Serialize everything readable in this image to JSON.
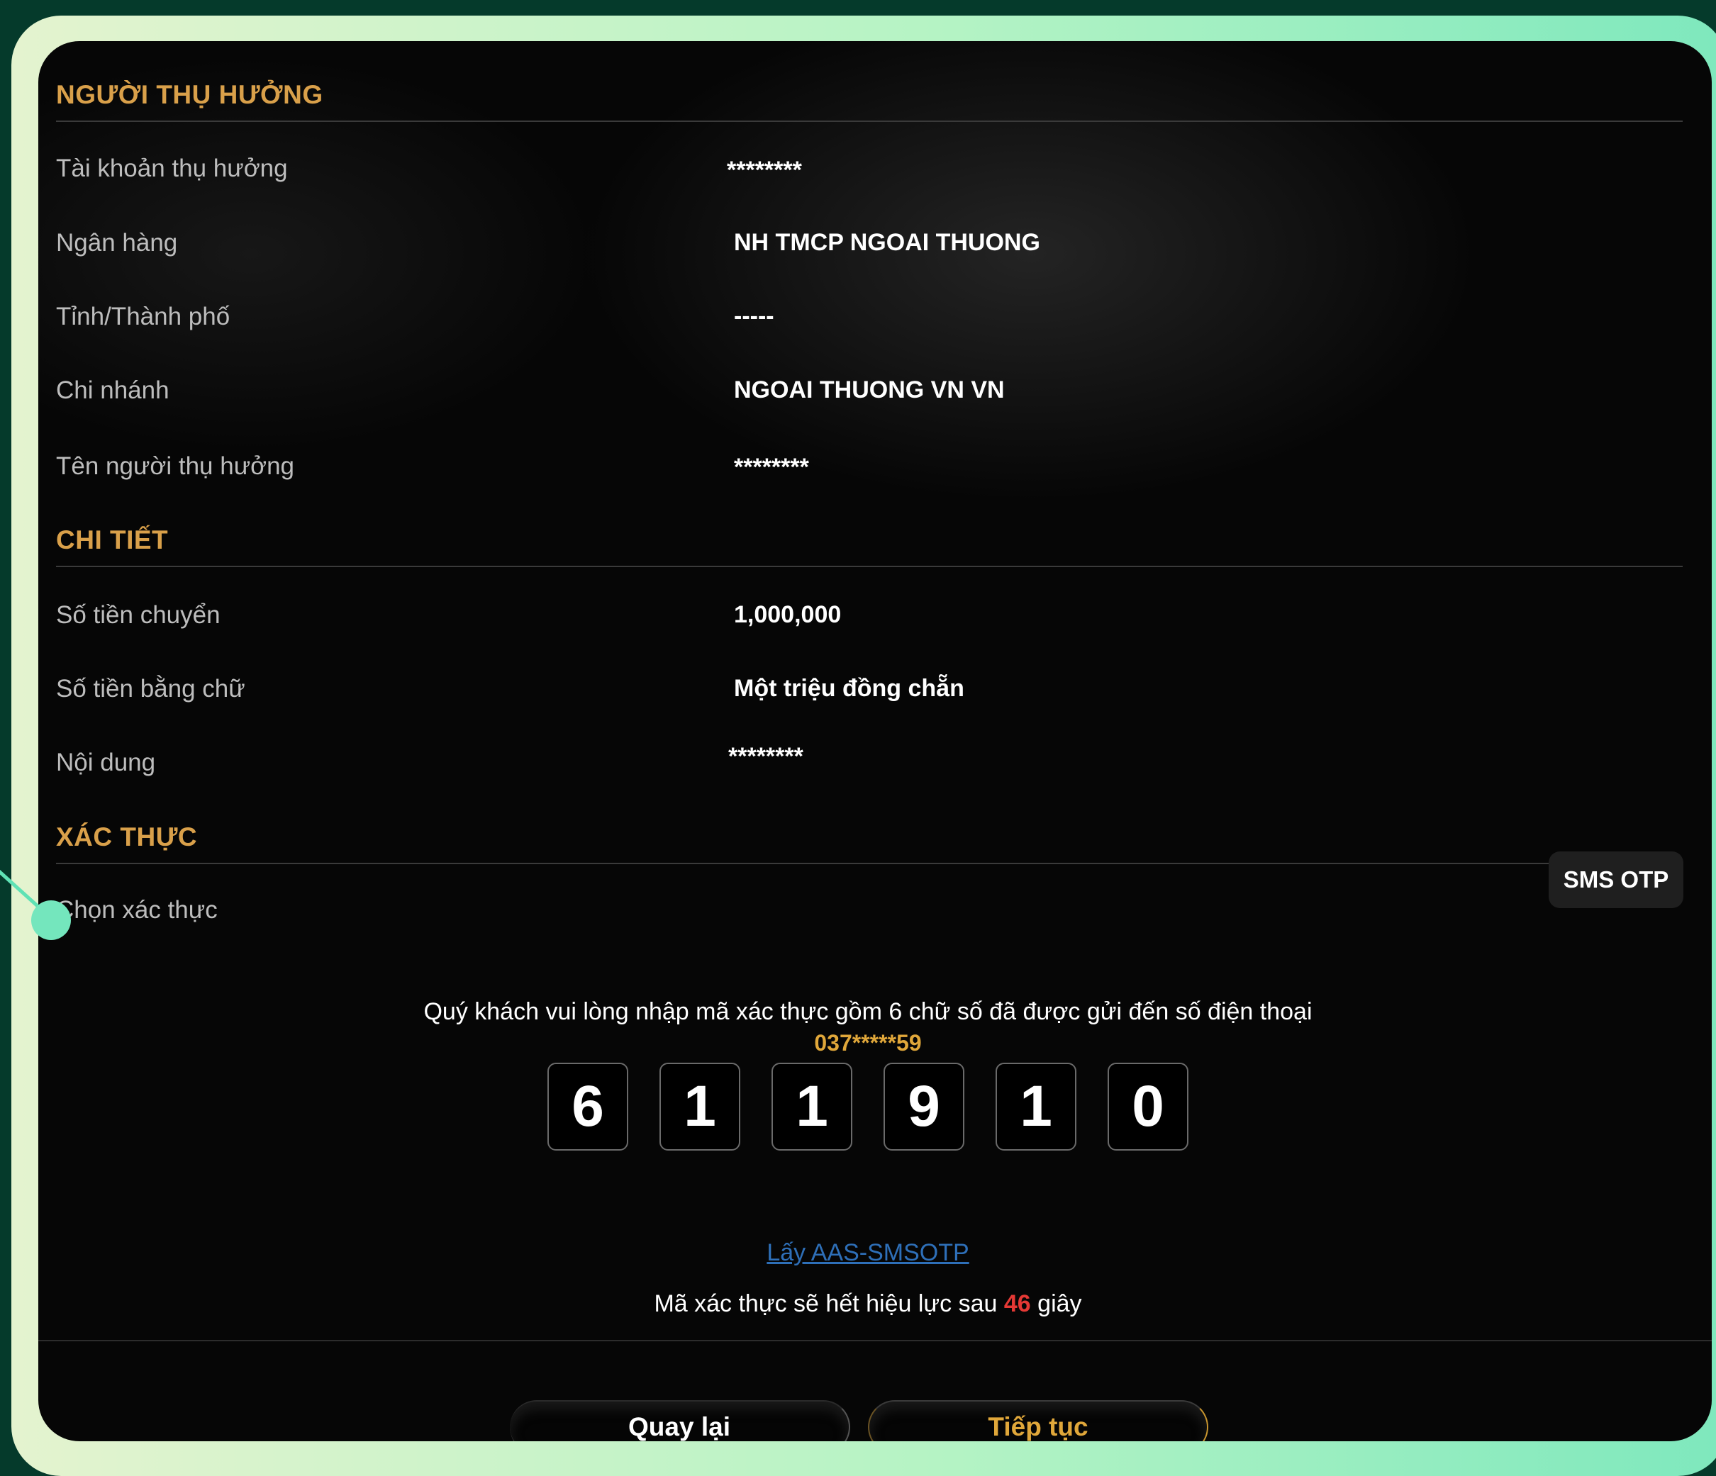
{
  "sections": {
    "beneficiary": "NGƯỜI THỤ HƯỞNG",
    "details": "CHI TIẾT",
    "auth": "XÁC THỰC"
  },
  "beneficiary": {
    "account_label": "Tài khoản thụ hưởng",
    "account_value": "********",
    "bank_label": "Ngân hàng",
    "bank_value": "NH TMCP NGOAI THUONG",
    "city_label": "Tỉnh/Thành phố",
    "city_value": "-----",
    "branch_label": "Chi nhánh",
    "branch_value": "NGOAI THUONG VN VN",
    "name_label": "Tên người thụ hưởng",
    "name_value": "********"
  },
  "details": {
    "amount_label": "Số tiền chuyển",
    "amount_value": "1,000,000",
    "amount_words_label": "Số tiền bằng chữ",
    "amount_words_value": "Một triệu đồng chẵn",
    "content_label": "Nội dung",
    "content_value": "********"
  },
  "auth": {
    "method_label": "Chọn xác thực",
    "method_value": "SMS OTP",
    "instruction": "Quý khách vui lòng nhập mã xác thực gồm 6 chữ số đã được gửi đến số điện thoại",
    "phone": "037*****59",
    "otp_digits": [
      "6",
      "1",
      "1",
      "9",
      "1",
      "0"
    ],
    "get_otp_link": "Lấy AAS-SMSOTP",
    "expire_prefix": "Mã xác thực sẽ hết hiệu lực sau",
    "expire_seconds": "46",
    "expire_suffix": "giây"
  },
  "buttons": {
    "back": "Quay lại",
    "next": "Tiếp tục"
  },
  "colors": {
    "accent_gold": "#d9a04a",
    "countdown_red": "#e53935",
    "link_blue": "#2e6fb8",
    "frame_green": "#053a2b"
  }
}
